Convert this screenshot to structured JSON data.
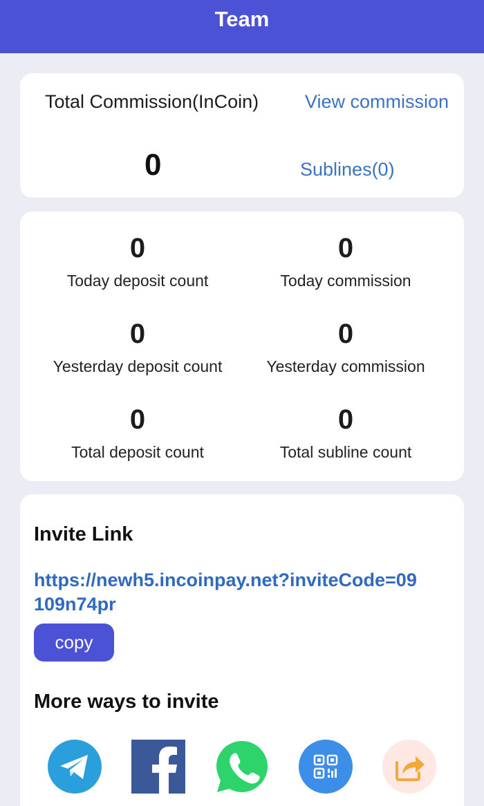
{
  "header": {
    "title": "Team"
  },
  "commission": {
    "label": "Total Commission(InCoin)",
    "view_link": "View commission",
    "value": "0",
    "sublines_link": "Sublines(0)"
  },
  "stats": [
    {
      "value": "0",
      "label": "Today deposit count"
    },
    {
      "value": "0",
      "label": "Today commission"
    },
    {
      "value": "0",
      "label": "Yesterday deposit count"
    },
    {
      "value": "0",
      "label": "Yesterday commission"
    },
    {
      "value": "0",
      "label": "Total deposit count"
    },
    {
      "value": "0",
      "label": "Total subline count"
    }
  ],
  "invite": {
    "title": "Invite Link",
    "link": "https://newh5.incoinpay.net?inviteCode=09109n74pr",
    "copy_label": "copy",
    "more_title": "More ways to invite"
  },
  "share_icons": [
    "telegram-icon",
    "facebook-icon",
    "whatsapp-icon",
    "qr-code-icon",
    "share-icon"
  ],
  "colors": {
    "header": "#4b52d6",
    "link": "#3a73c0",
    "background": "#ecedf4",
    "telegram": "#2b9fdb",
    "facebook": "#3b5998",
    "whatsapp": "#2cd46b",
    "qr": "#3d8ee8",
    "share_bg": "#fde8e4",
    "share_arrow": "#f3a93a"
  }
}
